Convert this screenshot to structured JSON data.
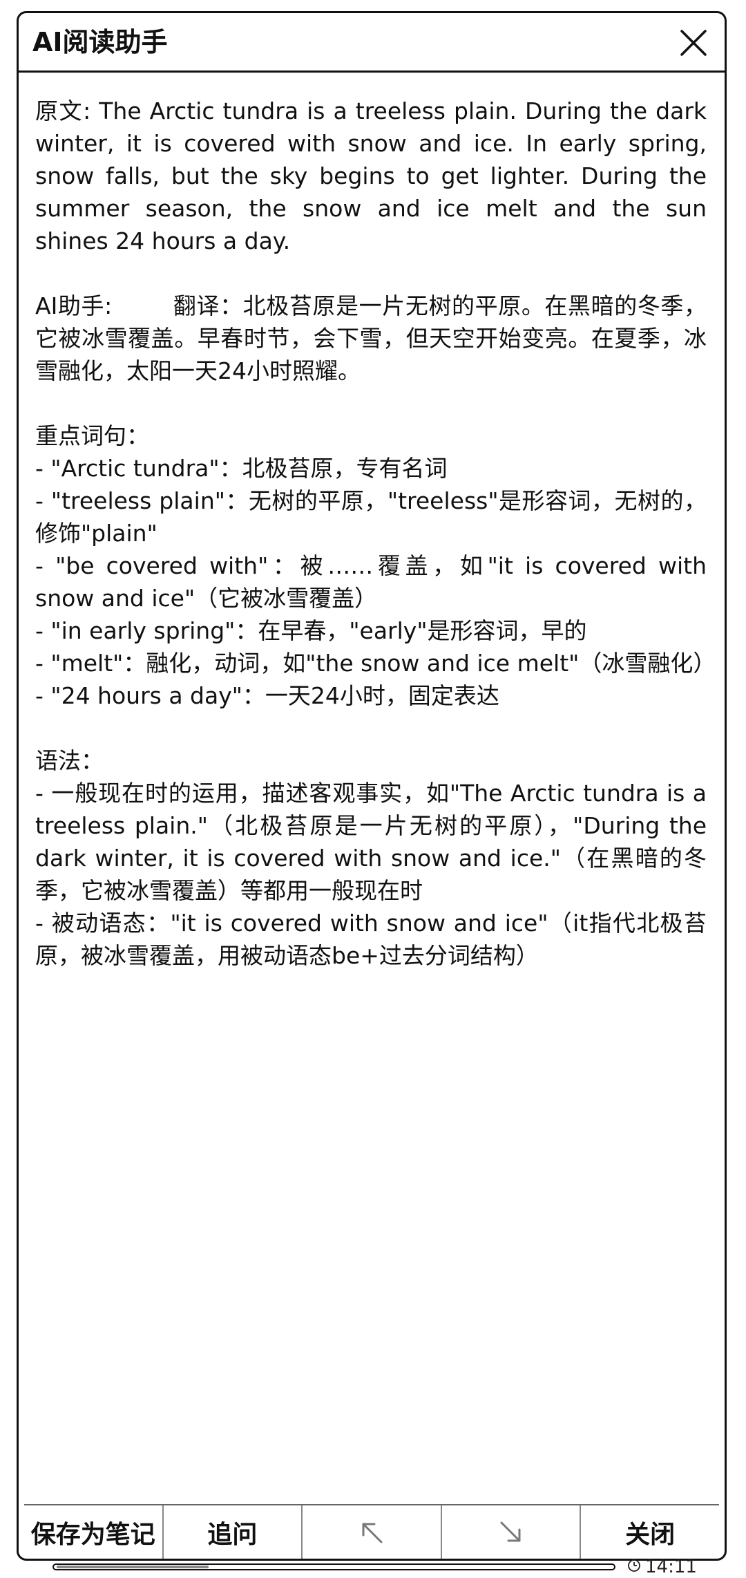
{
  "dialog": {
    "title": "AI阅读助手",
    "close_icon": "close-icon"
  },
  "content": {
    "paragraphs": [
      "原文: The Arctic tundra is a treeless plain. During the dark winter, it is covered with snow and ice. In early spring, snow falls, but the sky begins to get lighter. During the summer season, the snow and ice melt and the sun shines 24 hours a day.",
      "",
      "AI助手:        翻译：北极苔原是一片无树的平原。在黑暗的冬季，它被冰雪覆盖。早春时节，会下雪，但天空开始变亮。在夏季，冰雪融化，太阳一天24小时照耀。",
      "",
      "重点词句：",
      "- \"Arctic tundra\"：北极苔原，专有名词",
      "- \"treeless plain\"：无树的平原，\"treeless\"是形容词，无树的，修饰\"plain\"",
      "- \"be covered with\"：被……覆盖，如\"it is covered with snow and ice\"（它被冰雪覆盖）",
      "- \"in early spring\"：在早春，\"early\"是形容词，早的",
      "- \"melt\"：融化，动词，如\"the snow and ice melt\"（冰雪融化）",
      "- \"24 hours a day\"：一天24小时，固定表达",
      "",
      "语法：",
      "- 一般现在时的运用，描述客观事实，如\"The Arctic tundra is a treeless plain.\"（北极苔原是一片无树的平原），\"During the dark winter, it is covered with snow and ice.\"（在黑暗的冬季，它被冰雪覆盖）等都用一般现在时",
      "- 被动语态：\"it is covered with snow and ice\"（it指代北极苔原，被冰雪覆盖，用被动语态be+过去分词结构）"
    ]
  },
  "toolbar": {
    "save_note_label": "保存为笔记",
    "follow_up_label": "追问",
    "expand_icon": "arrow-up-left-icon",
    "collapse_icon": "arrow-down-right-icon",
    "close_label": "关闭"
  },
  "status": {
    "time": "14:11",
    "clock_icon": "clock-icon"
  }
}
